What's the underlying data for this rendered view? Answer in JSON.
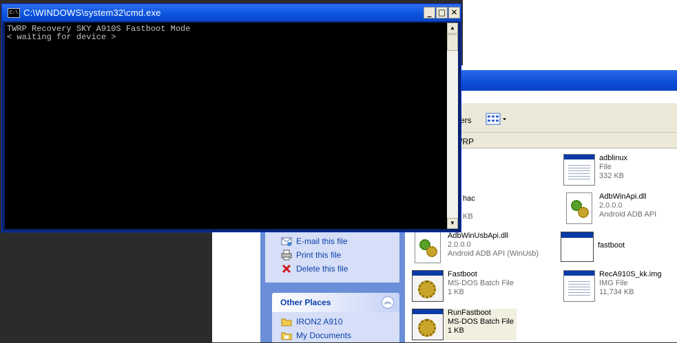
{
  "cmd": {
    "title": "C:\\WINDOWS\\system32\\cmd.exe",
    "icon_text": "C:\\",
    "lines": [
      "TWRP Recovery SKY A910S Fastboot Mode",
      "< waiting for device >"
    ],
    "buttons": {
      "minimize": "_",
      "maximize": "□",
      "close": "✕"
    },
    "scroll_up": "▲",
    "scroll_down": "▼"
  },
  "explorer": {
    "toolbar_folders": "ers",
    "address_text": "/RP",
    "tasks": [
      {
        "label": "E-mail this file",
        "icon": "email-icon"
      },
      {
        "label": "Print this file",
        "icon": "printer-icon"
      },
      {
        "label": "Delete this file",
        "icon": "delete-x-icon"
      }
    ],
    "other_places": {
      "title": "Other Places",
      "chevron": "︽",
      "items": [
        {
          "label": "IRON2 A910",
          "icon": "folder-icon"
        },
        {
          "label": "My Documents",
          "icon": "folder-icon"
        }
      ]
    },
    "files": [
      {
        "name": "adblinux",
        "line2": "File",
        "line3": "332 KB",
        "icon": "generic-file-icon"
      },
      {
        "name": "hac",
        "line2": "",
        "line3": "KB",
        "icon": "generic-file-icon"
      },
      {
        "name": "AdbWinApi.dll",
        "line2": "2.0.0.0",
        "line3": "Android ADB API",
        "icon": "dll-icon"
      },
      {
        "name": "AdbWinUsbApi.dll",
        "line2": "2.0.0.0",
        "line3": "Android ADB API (WinUsb)",
        "icon": "dll-icon"
      },
      {
        "name": "fastboot",
        "line2": "",
        "line3": "",
        "icon": "application-icon"
      },
      {
        "name": "Fastboot",
        "line2": "MS-DOS Batch File",
        "line3": "1 KB",
        "icon": "batch-file-icon"
      },
      {
        "name": "RecA910S_kk.img",
        "line2": "IMG File",
        "line3": "11,734 KB",
        "icon": "generic-file-icon"
      },
      {
        "name": "RunFastboot",
        "line2": "MS-DOS Batch File",
        "line3": "1 KB",
        "icon": "batch-file-icon"
      }
    ]
  }
}
